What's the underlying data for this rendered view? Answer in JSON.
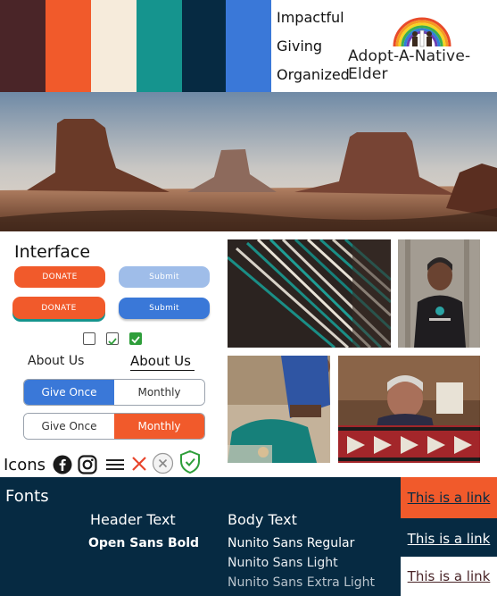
{
  "palette": {
    "swatches": [
      "#4a2528",
      "#f15a2b",
      "#f6ebdb",
      "#15948e",
      "#062a42",
      "#3a78d8"
    ]
  },
  "brand": {
    "keywords": [
      "Impactful",
      "Giving",
      "Organized"
    ],
    "logo_text": "Adopt-A-Native-Elder"
  },
  "interface": {
    "title": "Interface",
    "donate_label": "DONATE",
    "submit_label": "Submit",
    "about_label": "About Us",
    "give_once_label": "Give Once",
    "monthly_label": "Monthly",
    "icons_label": "Icons",
    "colors": {
      "orange": "#f15a2b",
      "blue": "#3a78d8",
      "light_blue": "#9fbde9",
      "green": "#2e9e3a"
    }
  },
  "fonts": {
    "title": "Fonts",
    "header_label": "Header Text",
    "header_font": "Open Sans Bold",
    "body_label": "Body Text",
    "body_fonts": [
      "Nunito Sans Regular",
      "Nunito Sans Light",
      "Nunito Sans Extra Light"
    ]
  },
  "links": {
    "label": "This is a link"
  }
}
